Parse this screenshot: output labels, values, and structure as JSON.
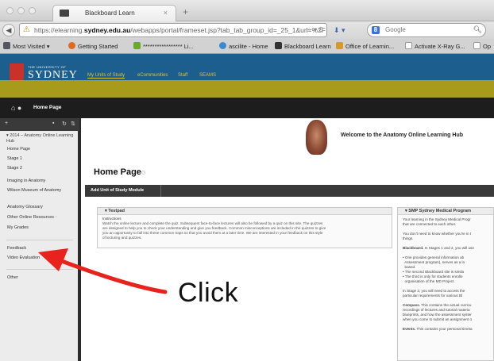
{
  "browser": {
    "tab_title": "Blackboard Learn",
    "tab_close": "×",
    "new_tab": "+",
    "url_prefix": "https://elearning.",
    "url_domain": "sydney.edu.au",
    "url_rest": "/webapps/portal/frameset.jsp?tab_tab_group_id=_25_1&url=%2F",
    "url_tools": "☆ ▾ C",
    "search_placeholder": "Google",
    "search_engine_letter": "8",
    "bookmarks": [
      "Most Visited",
      "Getting Started",
      "***************** Li...",
      "ascilite - Home",
      "Blackboard Learn",
      "Office of Learnin...",
      "Activate X-Ray G...",
      "Op"
    ]
  },
  "site": {
    "logo_small": "THE UNIVERSITY OF",
    "logo_big": "SYDNEY",
    "top_nav": [
      "My Units of Study",
      "eCommunities",
      "Staff",
      "SEAMS"
    ],
    "breadcrumb": "Home Page"
  },
  "sidebar": {
    "course_title": "2014 – Anatomy Online Learning Hub",
    "items": [
      "Home Page",
      "Stage 1",
      "Stage 2",
      "Imaging in Anatomy",
      "Wilson Museum of Anatomy",
      "Anatomy Glossary",
      "Other Online Resources",
      "My Grades",
      "Feedback",
      "Video Evaluation",
      "Other"
    ]
  },
  "main": {
    "banner_text": "Welcome to the Anatomy Online Learning Hub",
    "page_title": "Home Page",
    "action_button": "Add Unit of Study Module",
    "modules": {
      "left": {
        "title": "Testpad",
        "subtitle": "Instructions",
        "body": [
          "Watch the online lecture and complete the quiz. Subsequent face-to-face lectures will also be followed by a quiz on this site. The quizzes",
          "are designed to help you to check your understanding and give you feedback. Common misconceptions are included in the quizzes to give",
          "you an opportunity to fall into these common traps so that you avoid them at a later time. We are interested in your feedback on this style",
          "of lecturing and quizzes."
        ]
      },
      "right": {
        "title": "SMP Sydney Medical Program",
        "body": [
          "Your learning in the Sydney Medical Progr",
          "that are connected to each other.",
          "",
          "You don't need to know whether you're in t",
          "things.",
          "",
          "Blackboard. In Stages 1 and 2, you will use",
          "",
          "• One provides general information ab",
          "  Assessment program), serves as a lo",
          "  based.",
          "• The second Blackboard site is simila",
          "• The third is only for students enrolle",
          "  organisation of the MD Project.",
          "",
          "In Stage 3, you will need to access the",
          "particular requirements for various Bl",
          "",
          "Compass. This contains the actual curricu",
          "recordings of lectures and tutorial materia",
          "blueprints, and how the assessment syster",
          "when you come to submit an assignment o",
          "",
          "Events. This contains your personal timeta"
        ]
      }
    }
  },
  "annotation": {
    "label": "Click",
    "color": "#e8221c"
  }
}
